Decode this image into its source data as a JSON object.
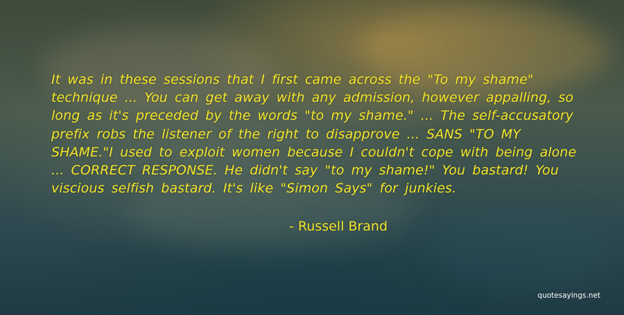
{
  "quote": {
    "text": "It was in these sessions that I first came across the \"To my shame\" technique ... You can get away with any admission, however appalling, so long as it's preceded by the words \"to my shame.\" ... The self-accusatory prefix robs the listener of the right to disapprove ... SANS \"TO MY SHAME.\"I used to exploit women because I couldn't cope with being alone ... CORRECT RESPONSE. He didn't say \"to my shame!\" You bastard! You viscious selfish bastard. It's like \"Simon Says\" for junkies.",
    "author": "- Russell Brand"
  },
  "watermark": "quotesayings.net",
  "colors": {
    "text": "#f5e62a",
    "background_top": "#3f4a3a",
    "background_bottom": "#1f3a42"
  }
}
